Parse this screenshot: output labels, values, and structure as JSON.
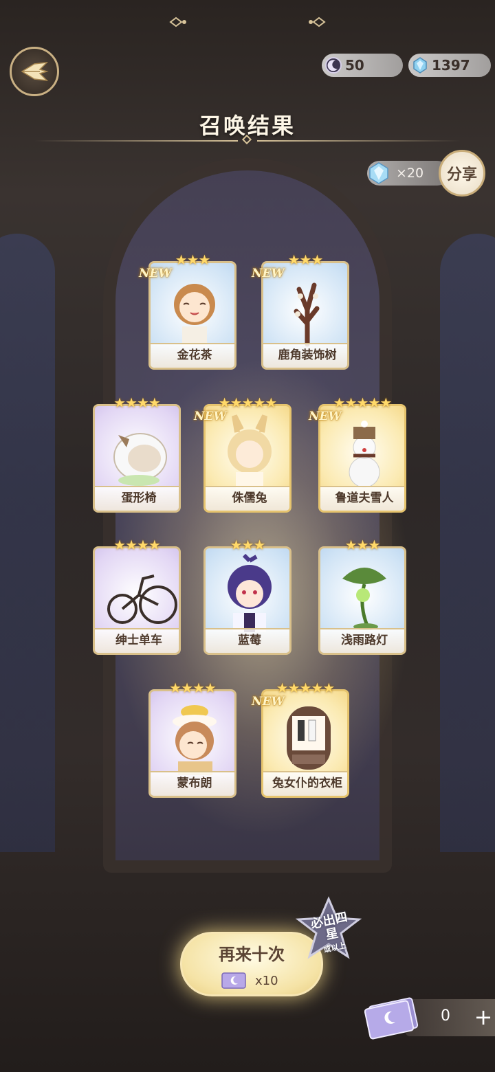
{
  "header": {
    "title": "召唤结果",
    "moon_currency": "50",
    "crystal_currency": "1397"
  },
  "share": {
    "count_label": "×20",
    "button_label": "分享"
  },
  "cards": [
    {
      "name": "金花茶",
      "stars": "★★★",
      "new": "NEW",
      "rarity": "r3",
      "icon": "girl-character-icon"
    },
    {
      "name": "鹿角装饰树",
      "stars": "★★★",
      "new": "NEW",
      "rarity": "r3",
      "icon": "antler-tree-icon"
    },
    {
      "name": "蛋形椅",
      "stars": "★★★★",
      "new": "",
      "rarity": "r4",
      "icon": "egg-chair-icon"
    },
    {
      "name": "侏儒兔",
      "stars": "★★★★★",
      "new": "NEW",
      "rarity": "r5",
      "icon": "bunny-girl-icon"
    },
    {
      "name": "鲁道夫雪人",
      "stars": "★★★★★",
      "new": "NEW",
      "rarity": "r5",
      "icon": "snowman-icon"
    },
    {
      "name": "绅士单车",
      "stars": "★★★★",
      "new": "",
      "rarity": "r4",
      "icon": "bicycle-icon"
    },
    {
      "name": "蓝莓",
      "stars": "★★★",
      "new": "",
      "rarity": "r3",
      "icon": "purple-hair-boy-icon"
    },
    {
      "name": "浅雨路灯",
      "stars": "★★★",
      "new": "",
      "rarity": "r3",
      "icon": "leaf-lamp-icon"
    },
    {
      "name": "蒙布朗",
      "stars": "★★★★",
      "new": "",
      "rarity": "r4",
      "icon": "cake-hat-boy-icon"
    },
    {
      "name": "兔女仆的衣柜",
      "stars": "★★★★★",
      "new": "NEW",
      "rarity": "r5",
      "icon": "wardrobe-icon"
    }
  ],
  "actions": {
    "again_label": "再来十次",
    "again_cost": "x10",
    "guarantee_main": "必出四星",
    "guarantee_sub": "或以上"
  },
  "tickets": {
    "count": "0",
    "plus": "+"
  },
  "colors": {
    "gold": "#d9c08a",
    "new_badge": "#fff4c6",
    "star": "#ffd96a"
  }
}
